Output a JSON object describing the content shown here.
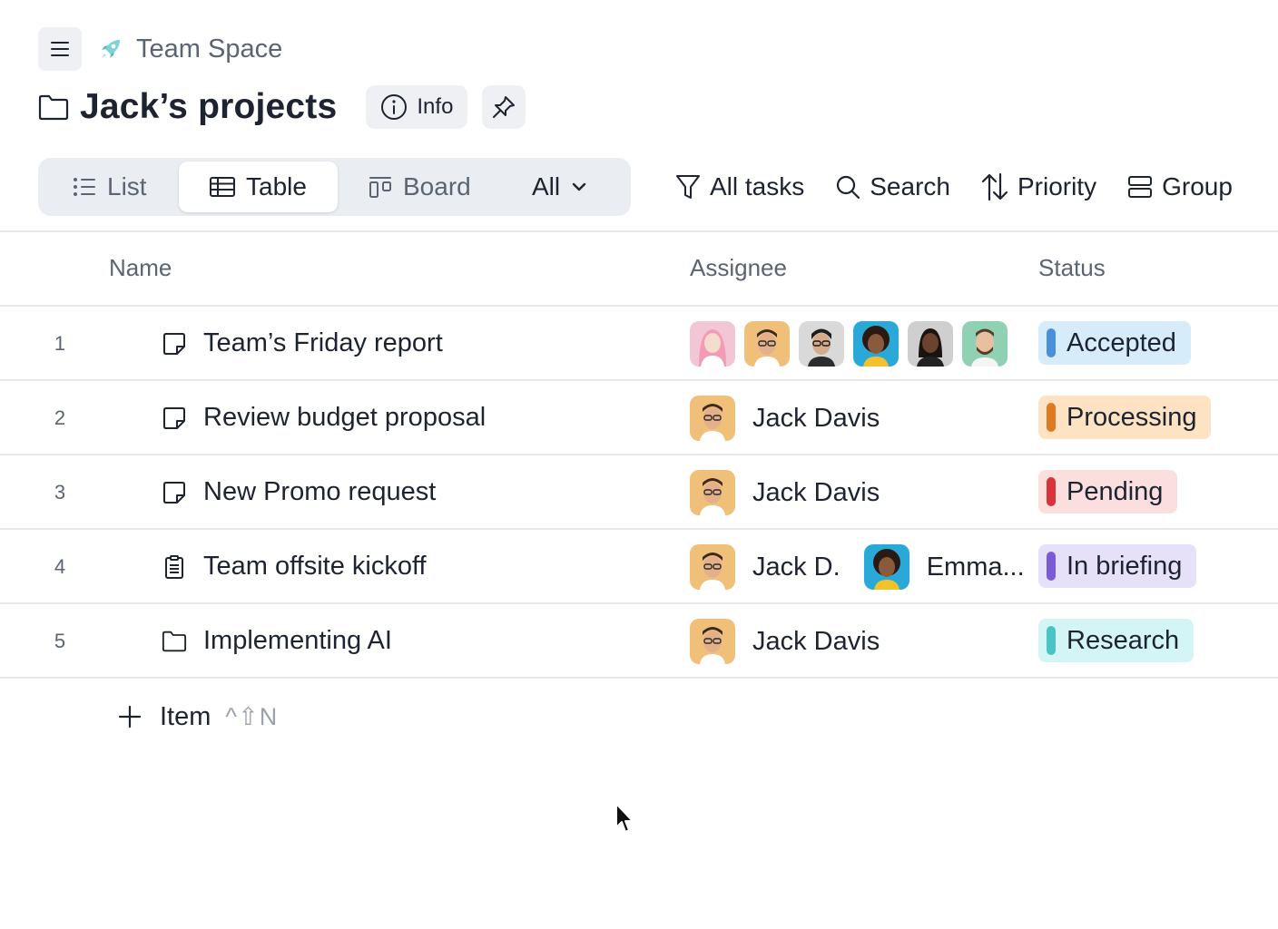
{
  "breadcrumb": {
    "space_name": "Team Space",
    "menu_icon": "hamburger-icon",
    "space_icon": "rocket-icon"
  },
  "page": {
    "title": "Jack’s projects",
    "info_label": "Info"
  },
  "views": {
    "list_label": "List",
    "table_label": "Table",
    "board_label": "Board",
    "filter_label": "All",
    "active": "Table"
  },
  "toolbar": {
    "all_tasks_label": "All tasks",
    "search_label": "Search",
    "priority_label": "Priority",
    "group_label": "Group"
  },
  "table": {
    "columns": {
      "name": "Name",
      "assignee": "Assignee",
      "status": "Status"
    },
    "rows": [
      {
        "num": "1",
        "icon": "note-icon",
        "name": "Team’s Friday report",
        "assignees": [],
        "status": "Accepted",
        "status_color": "#4a90d9",
        "status_bg": "#d6ecfa"
      },
      {
        "num": "2",
        "icon": "note-icon",
        "name": "Review budget proposal",
        "assignees": [
          "Jack Davis"
        ],
        "status": "Processing",
        "status_color": "#dd7a22",
        "status_bg": "#fde3c4"
      },
      {
        "num": "3",
        "icon": "note-icon",
        "name": "New Promo request",
        "assignees": [
          "Jack Davis"
        ],
        "status": "Pending",
        "status_color": "#d8323a",
        "status_bg": "#fbdede"
      },
      {
        "num": "4",
        "icon": "clipboard-icon",
        "name": "Team offsite kickoff",
        "assignees": [
          "Jack D.",
          "Emma..."
        ],
        "status": "In briefing",
        "status_color": "#7b5bd6",
        "status_bg": "#e6e1f9"
      },
      {
        "num": "5",
        "icon": "folder-icon",
        "name": "Implementing AI",
        "assignees": [
          "Jack Davis"
        ],
        "status": "Research",
        "status_color": "#49c3c7",
        "status_bg": "#d4f5f5"
      }
    ]
  },
  "add_item": {
    "label": "Item",
    "shortcut": "^⇧N"
  }
}
